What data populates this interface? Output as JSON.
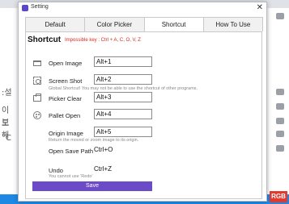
{
  "window": {
    "title": "Setting",
    "close_label": "✕"
  },
  "tabs": [
    {
      "label": "Default"
    },
    {
      "label": "Color Picker"
    },
    {
      "label": "Shortcut"
    },
    {
      "label": "How To Use"
    }
  ],
  "shortcut": {
    "heading": "Shortcut",
    "impossible_keys": "Impossible key : Ctrl + A, C, O, V, Z",
    "rows": [
      {
        "label": "Open Image",
        "value": "Alt+1"
      },
      {
        "label": "Screen Shot",
        "value": "Alt+2",
        "note": "Global Shortcut! You may not be able to use the shortcut of other programs."
      },
      {
        "label": "Picker Clear",
        "value": "Alt+3"
      },
      {
        "label": "Pallet Open",
        "value": "Alt+4"
      },
      {
        "label": "Origin Image",
        "value": "Alt+5",
        "note": "Return the moved or zoom image to its origin."
      },
      {
        "label": "Open Save Path",
        "value": "Ctrl+O"
      },
      {
        "label": "Undo",
        "value": "Ctrl+Z",
        "note": "You cannot use 'Redo'"
      }
    ],
    "save_label": "Save"
  },
  "background": {
    "korean_lines": [
      ":설",
      "이브",
      "도해",
      "°C"
    ],
    "rgb_badge": "RGB"
  },
  "colors": {
    "accent": "#6c4bc9",
    "warning": "#d6281a"
  },
  "icons": [
    "folder-icon",
    "screenshot-icon",
    "picker-icon",
    "palette-icon"
  ]
}
